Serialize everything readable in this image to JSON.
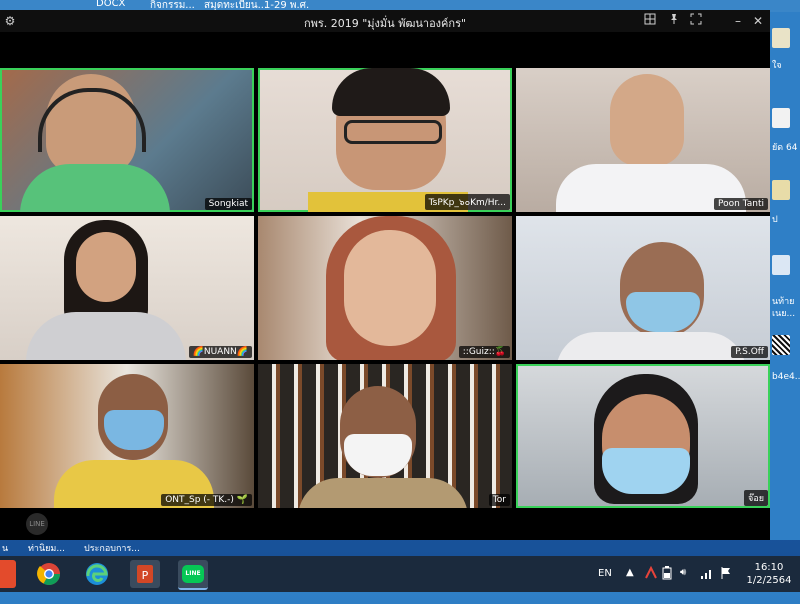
{
  "window": {
    "title": "กพร. 2019 \"มุ่งมั่น พัฒนาองค์กร\"",
    "icons": [
      "gear-icon",
      "gallery-view-icon",
      "pin-icon",
      "fullscreen-icon",
      "minimize-icon",
      "close-icon"
    ]
  },
  "participants": [
    {
      "name": "Songkiat",
      "active": true
    },
    {
      "name": "TsPKp_๖๐Km/Hr...",
      "active": true
    },
    {
      "name": "Poon Tanti",
      "active": false
    },
    {
      "name": "🌈NUANN🌈",
      "active": false
    },
    {
      "name": "::Guiz::🍒",
      "active": false
    },
    {
      "name": "P.S.Off",
      "active": false
    },
    {
      "name": "ONT_Sp (- TK.-) 🌱",
      "active": false
    },
    {
      "name": "Tor",
      "active": false
    },
    {
      "name": "จ๊อย",
      "active": true
    }
  ],
  "app_logo": "LINE",
  "desktop": {
    "top_labels": [
      "DOCX",
      "กิจกรรม...",
      "สมุดทะเบียน...",
      "1-29 พ.ศ."
    ],
    "right_labels": [
      "ใจ",
      "ยัด 64",
      "ป",
      "นท้าย",
      "เนย...",
      "b4e4..."
    ],
    "bottom_labels": [
      "น",
      "ท่านิยม...",
      "ประกอบการ..."
    ]
  },
  "taskbar": {
    "apps": [
      "chrome-icon",
      "edge-icon",
      "powerpoint-icon",
      "line-icon"
    ],
    "line_label": "LINE",
    "language": "EN",
    "time": "16:10",
    "date": "1/2/2564"
  }
}
